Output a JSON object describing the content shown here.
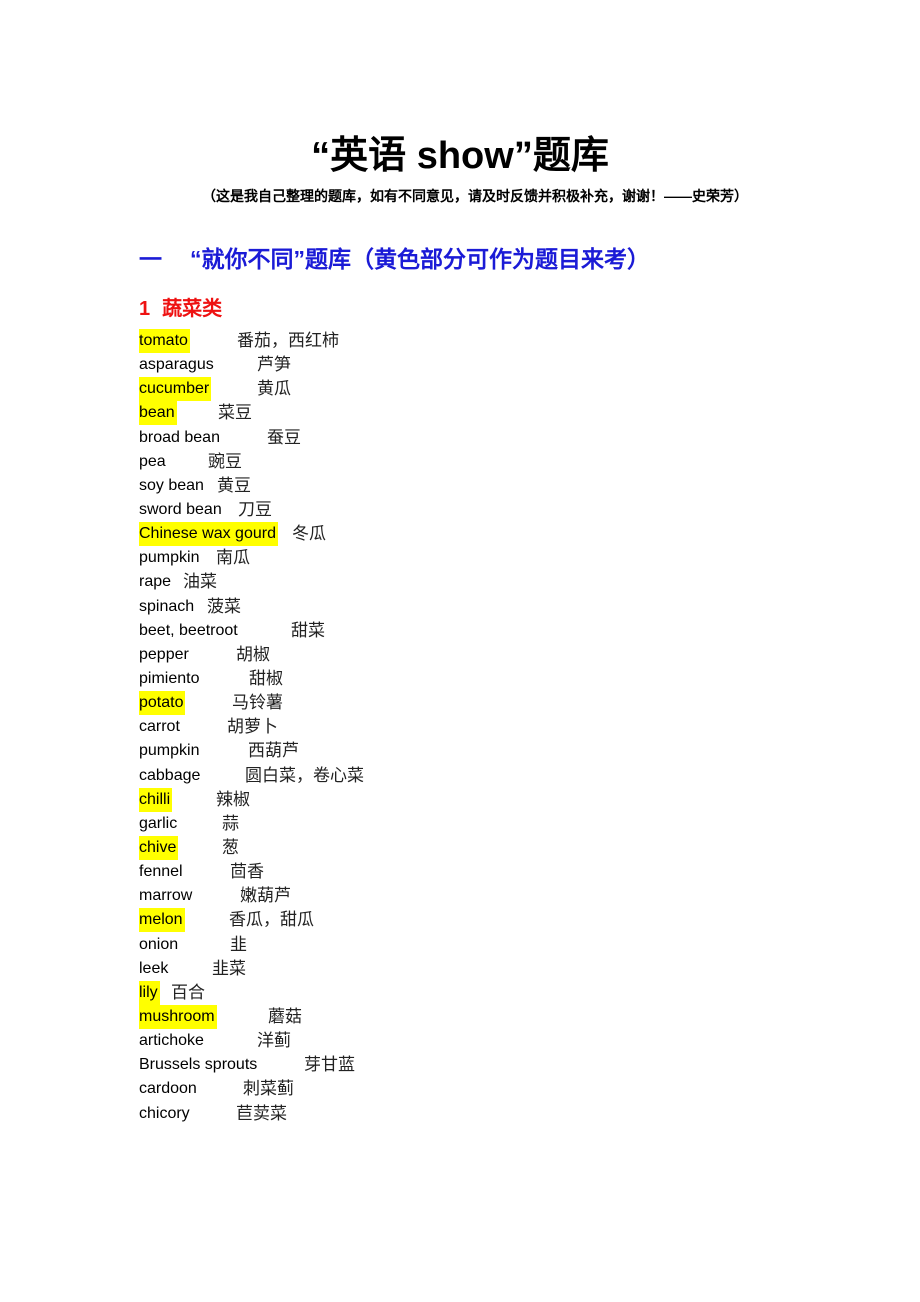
{
  "document": {
    "title": "“英语 show”题库",
    "subtitle": "（这是我自己整理的题库，如有不同意见，请及时反馈并积极补充，谢谢！——史荣芳）",
    "section": {
      "number": "一",
      "heading": "“就你不同”题库（黄色部分可作为题目来考）"
    },
    "subsection": {
      "number": "1",
      "heading": "蔬菜类"
    },
    "highlight_color": "#ffff00",
    "section_color": "#1b1bd6",
    "subsection_color": "#ee1111",
    "vocabulary": [
      {
        "en": "tomato",
        "zh": "番茄，西红柿",
        "highlighted": true
      },
      {
        "en": "asparagus",
        "zh": "芦笋",
        "highlighted": false
      },
      {
        "en": "cucumber",
        "zh": "黄瓜",
        "highlighted": true
      },
      {
        "en": "bean",
        "zh": "菜豆",
        "highlighted": true
      },
      {
        "en": "broad bean",
        "zh": "蚕豆",
        "highlighted": false
      },
      {
        "en": "pea",
        "zh": "豌豆",
        "highlighted": false
      },
      {
        "en": "soy bean",
        "zh": "黄豆",
        "highlighted": false
      },
      {
        "en": "sword bean",
        "zh": "刀豆",
        "highlighted": false
      },
      {
        "en": "Chinese wax gourd",
        "zh": "冬瓜",
        "highlighted": true
      },
      {
        "en": "pumpkin",
        "zh": "南瓜",
        "highlighted": false
      },
      {
        "en": "rape",
        "zh": "油菜",
        "highlighted": false
      },
      {
        "en": "spinach",
        "zh": "菠菜",
        "highlighted": false
      },
      {
        "en": "beet, beetroot",
        "zh": "甜菜",
        "highlighted": false
      },
      {
        "en": "pepper",
        "zh": "胡椒",
        "highlighted": false
      },
      {
        "en": "pimiento",
        "zh": "甜椒",
        "highlighted": false
      },
      {
        "en": "potato",
        "zh": "马铃薯",
        "highlighted": true
      },
      {
        "en": "carrot",
        "zh": "胡萝卜",
        "highlighted": false
      },
      {
        "en": "pumpkin",
        "zh": "西葫芦",
        "highlighted": false
      },
      {
        "en": "cabbage",
        "zh": "圆白菜，卷心菜",
        "highlighted": false
      },
      {
        "en": "chilli",
        "zh": "辣椒",
        "highlighted": true
      },
      {
        "en": "garlic",
        "zh": "蒜",
        "highlighted": false
      },
      {
        "en": "chive",
        "zh": "葱",
        "highlighted": true
      },
      {
        "en": "fennel",
        "zh": "茴香",
        "highlighted": false
      },
      {
        "en": "marrow",
        "zh": "嫩葫芦",
        "highlighted": false
      },
      {
        "en": "melon",
        "zh": "香瓜，甜瓜",
        "highlighted": true
      },
      {
        "en": "onion",
        "zh": "韭",
        "highlighted": false
      },
      {
        "en": "leek",
        "zh": "韭菜",
        "highlighted": false
      },
      {
        "en": "lily",
        "zh": "百合",
        "highlighted": true
      },
      {
        "en": "mushroom",
        "zh": "蘑菇",
        "highlighted": true
      },
      {
        "en": "artichoke",
        "zh": "洋蓟",
        "highlighted": false
      },
      {
        "en": "Brussels sprouts",
        "zh": "芽甘蓝",
        "highlighted": false
      },
      {
        "en": "cardoon",
        "zh": "刺菜蓟",
        "highlighted": false
      },
      {
        "en": "chicory",
        "zh": "苣荬菜",
        "highlighted": false
      }
    ]
  }
}
